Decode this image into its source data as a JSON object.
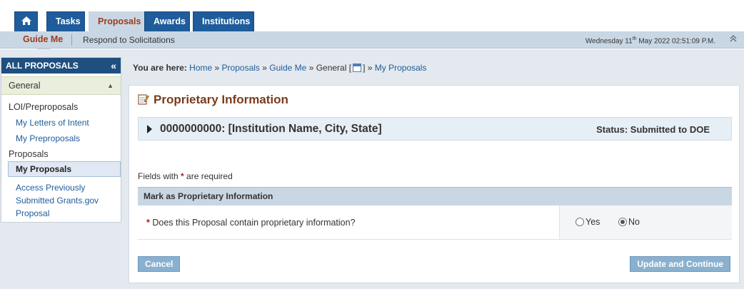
{
  "tabs": {
    "tasks": "Tasks",
    "proposals": "Proposals",
    "awards": "Awards",
    "institutions": "Institutions"
  },
  "subnav": {
    "guide_me": "Guide Me",
    "respond": "Respond to Solicitations",
    "date_prefix": "Wednesday 11",
    "date_sup": "th",
    "date_suffix": " May 2022 02:51:09 P.M."
  },
  "sidebar": {
    "title": "ALL PROPOSALS",
    "group": "General",
    "section1": "LOI/Preproposals",
    "link_loi": "My Letters of Intent",
    "link_preproposals": "My Preproposals",
    "section2": "Proposals",
    "link_my_proposals": "My Proposals",
    "link_grants_gov": "Access Previously Submitted Grants.gov Proposal"
  },
  "breadcrumb": {
    "label": "You are here:",
    "home": "Home",
    "proposals": "Proposals",
    "guide_me": "Guide Me",
    "general_pre": "General [",
    "general_post": "]",
    "my_proposals": "My Proposals",
    "sep": "»"
  },
  "panel": {
    "title": "Proprietary Information",
    "record_name": "0000000000: [Institution Name, City, State]",
    "status": "Status: Submitted to DOE",
    "required_pre": "Fields with",
    "required_post": "are required",
    "section_title": "Mark as Proprietary Information",
    "question": "Does this Proposal contain proprietary information?",
    "opt_yes": "Yes",
    "opt_no": "No",
    "selected": "No",
    "cancel": "Cancel",
    "update": "Update and Continue"
  },
  "colors": {
    "nav_blue": "#1e5c9b",
    "accent_rust": "#a03a1a",
    "button": "#89b0cf"
  }
}
